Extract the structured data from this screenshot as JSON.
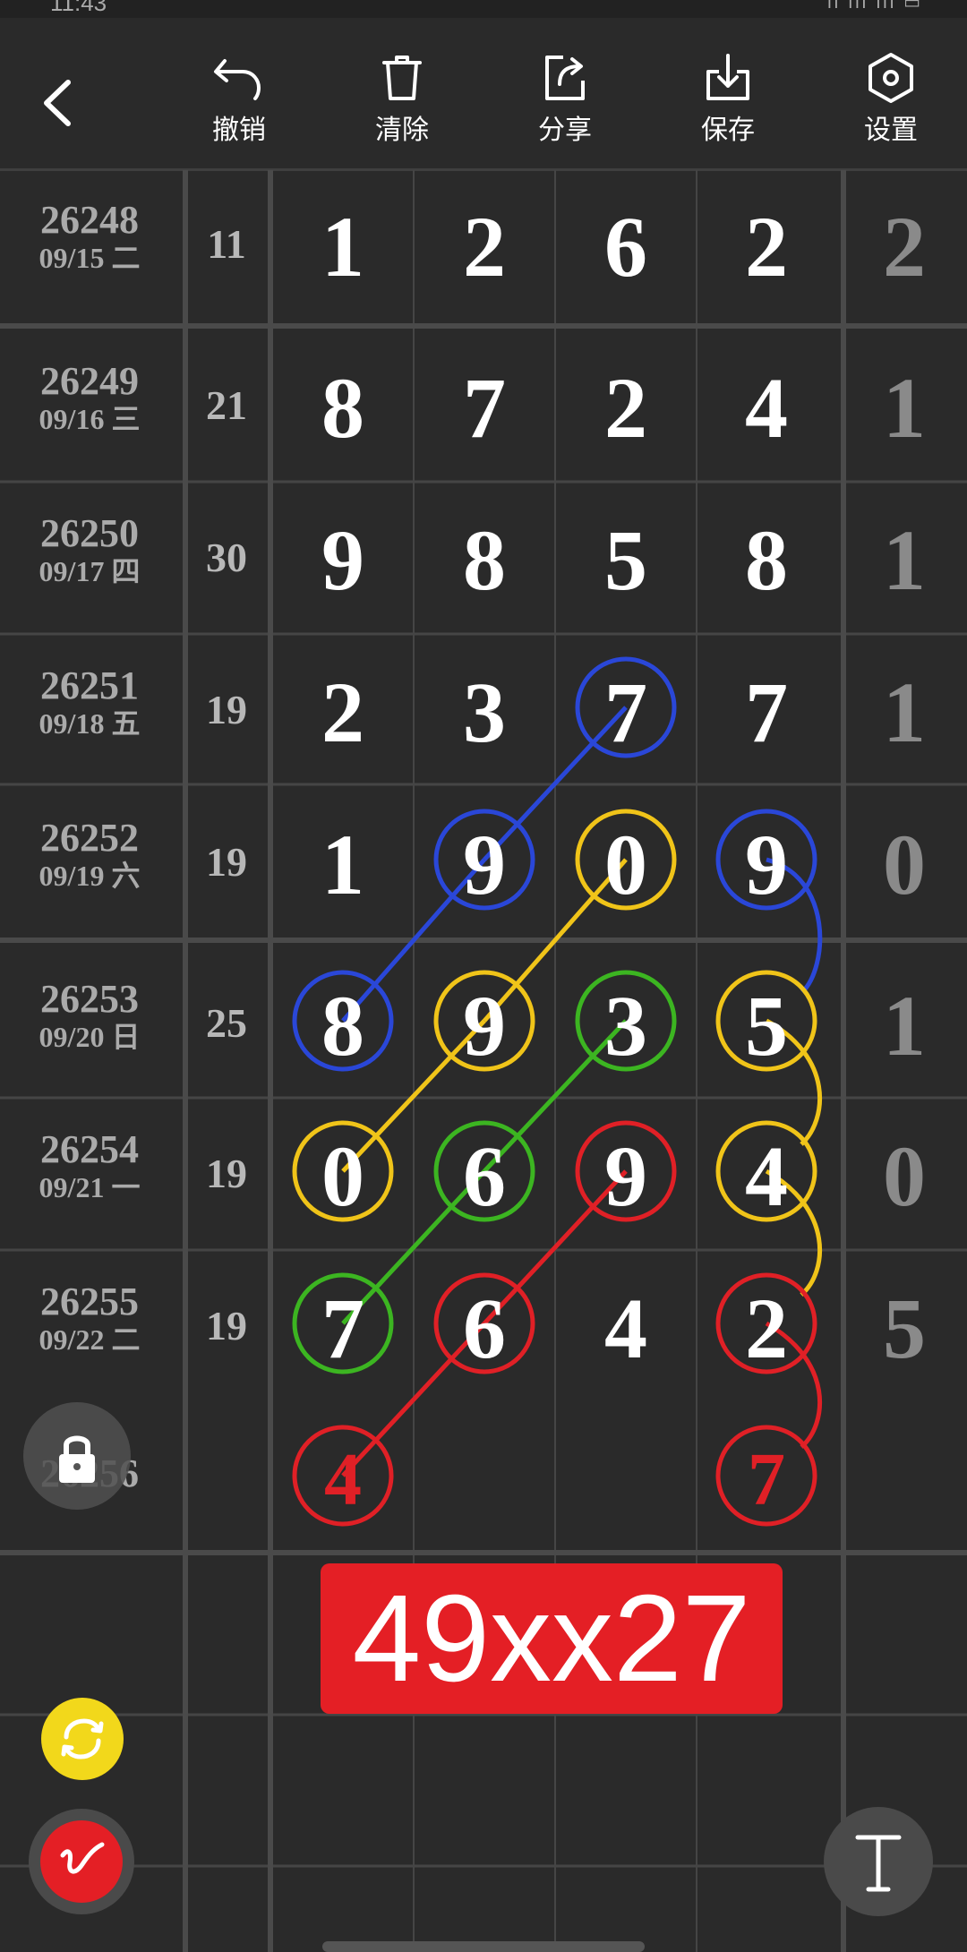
{
  "status": {
    "time": "11:43",
    "icons": "ıl  ıll  ıll  ▭"
  },
  "toolbar": {
    "undo": "撤销",
    "clear": "清除",
    "share": "分享",
    "save": "保存",
    "settings": "设置"
  },
  "rows": [
    {
      "issue": "26248",
      "date": "09/15 二",
      "sum": "11",
      "digits": [
        "1",
        "2",
        "6",
        "2"
      ],
      "last": "2"
    },
    {
      "issue": "26249",
      "date": "09/16 三",
      "sum": "21",
      "digits": [
        "8",
        "7",
        "2",
        "4"
      ],
      "last": "1"
    },
    {
      "issue": "26250",
      "date": "09/17 四",
      "sum": "30",
      "digits": [
        "9",
        "8",
        "5",
        "8"
      ],
      "last": "1"
    },
    {
      "issue": "26251",
      "date": "09/18 五",
      "sum": "19",
      "digits": [
        "2",
        "3",
        "7",
        "7"
      ],
      "last": "1"
    },
    {
      "issue": "26252",
      "date": "09/19 六",
      "sum": "19",
      "digits": [
        "1",
        "9",
        "0",
        "9"
      ],
      "last": "0"
    },
    {
      "issue": "26253",
      "date": "09/20 日",
      "sum": "25",
      "digits": [
        "8",
        "9",
        "3",
        "5"
      ],
      "last": "1"
    },
    {
      "issue": "26254",
      "date": "09/21 一",
      "sum": "19",
      "digits": [
        "0",
        "6",
        "9",
        "4"
      ],
      "last": "0"
    },
    {
      "issue": "26255",
      "date": "09/22 二",
      "sum": "19",
      "digits": [
        "7",
        "6",
        "4",
        "2"
      ],
      "last": "5"
    },
    {
      "issue": "26256",
      "date": "",
      "sum": "",
      "digits": [
        "4",
        "",
        "",
        "7"
      ],
      "last": ""
    }
  ],
  "result": "49xx27",
  "colors": {
    "blue": "#2a47d8",
    "yellow": "#f0c419",
    "green": "#3cb521",
    "red": "#e02026",
    "result_bg": "#e41f25"
  },
  "icons": [
    "back-icon",
    "undo-icon",
    "trash-icon",
    "share-icon",
    "download-icon",
    "settings-icon",
    "lock-icon",
    "refresh-icon",
    "pen-icon",
    "text-icon"
  ]
}
